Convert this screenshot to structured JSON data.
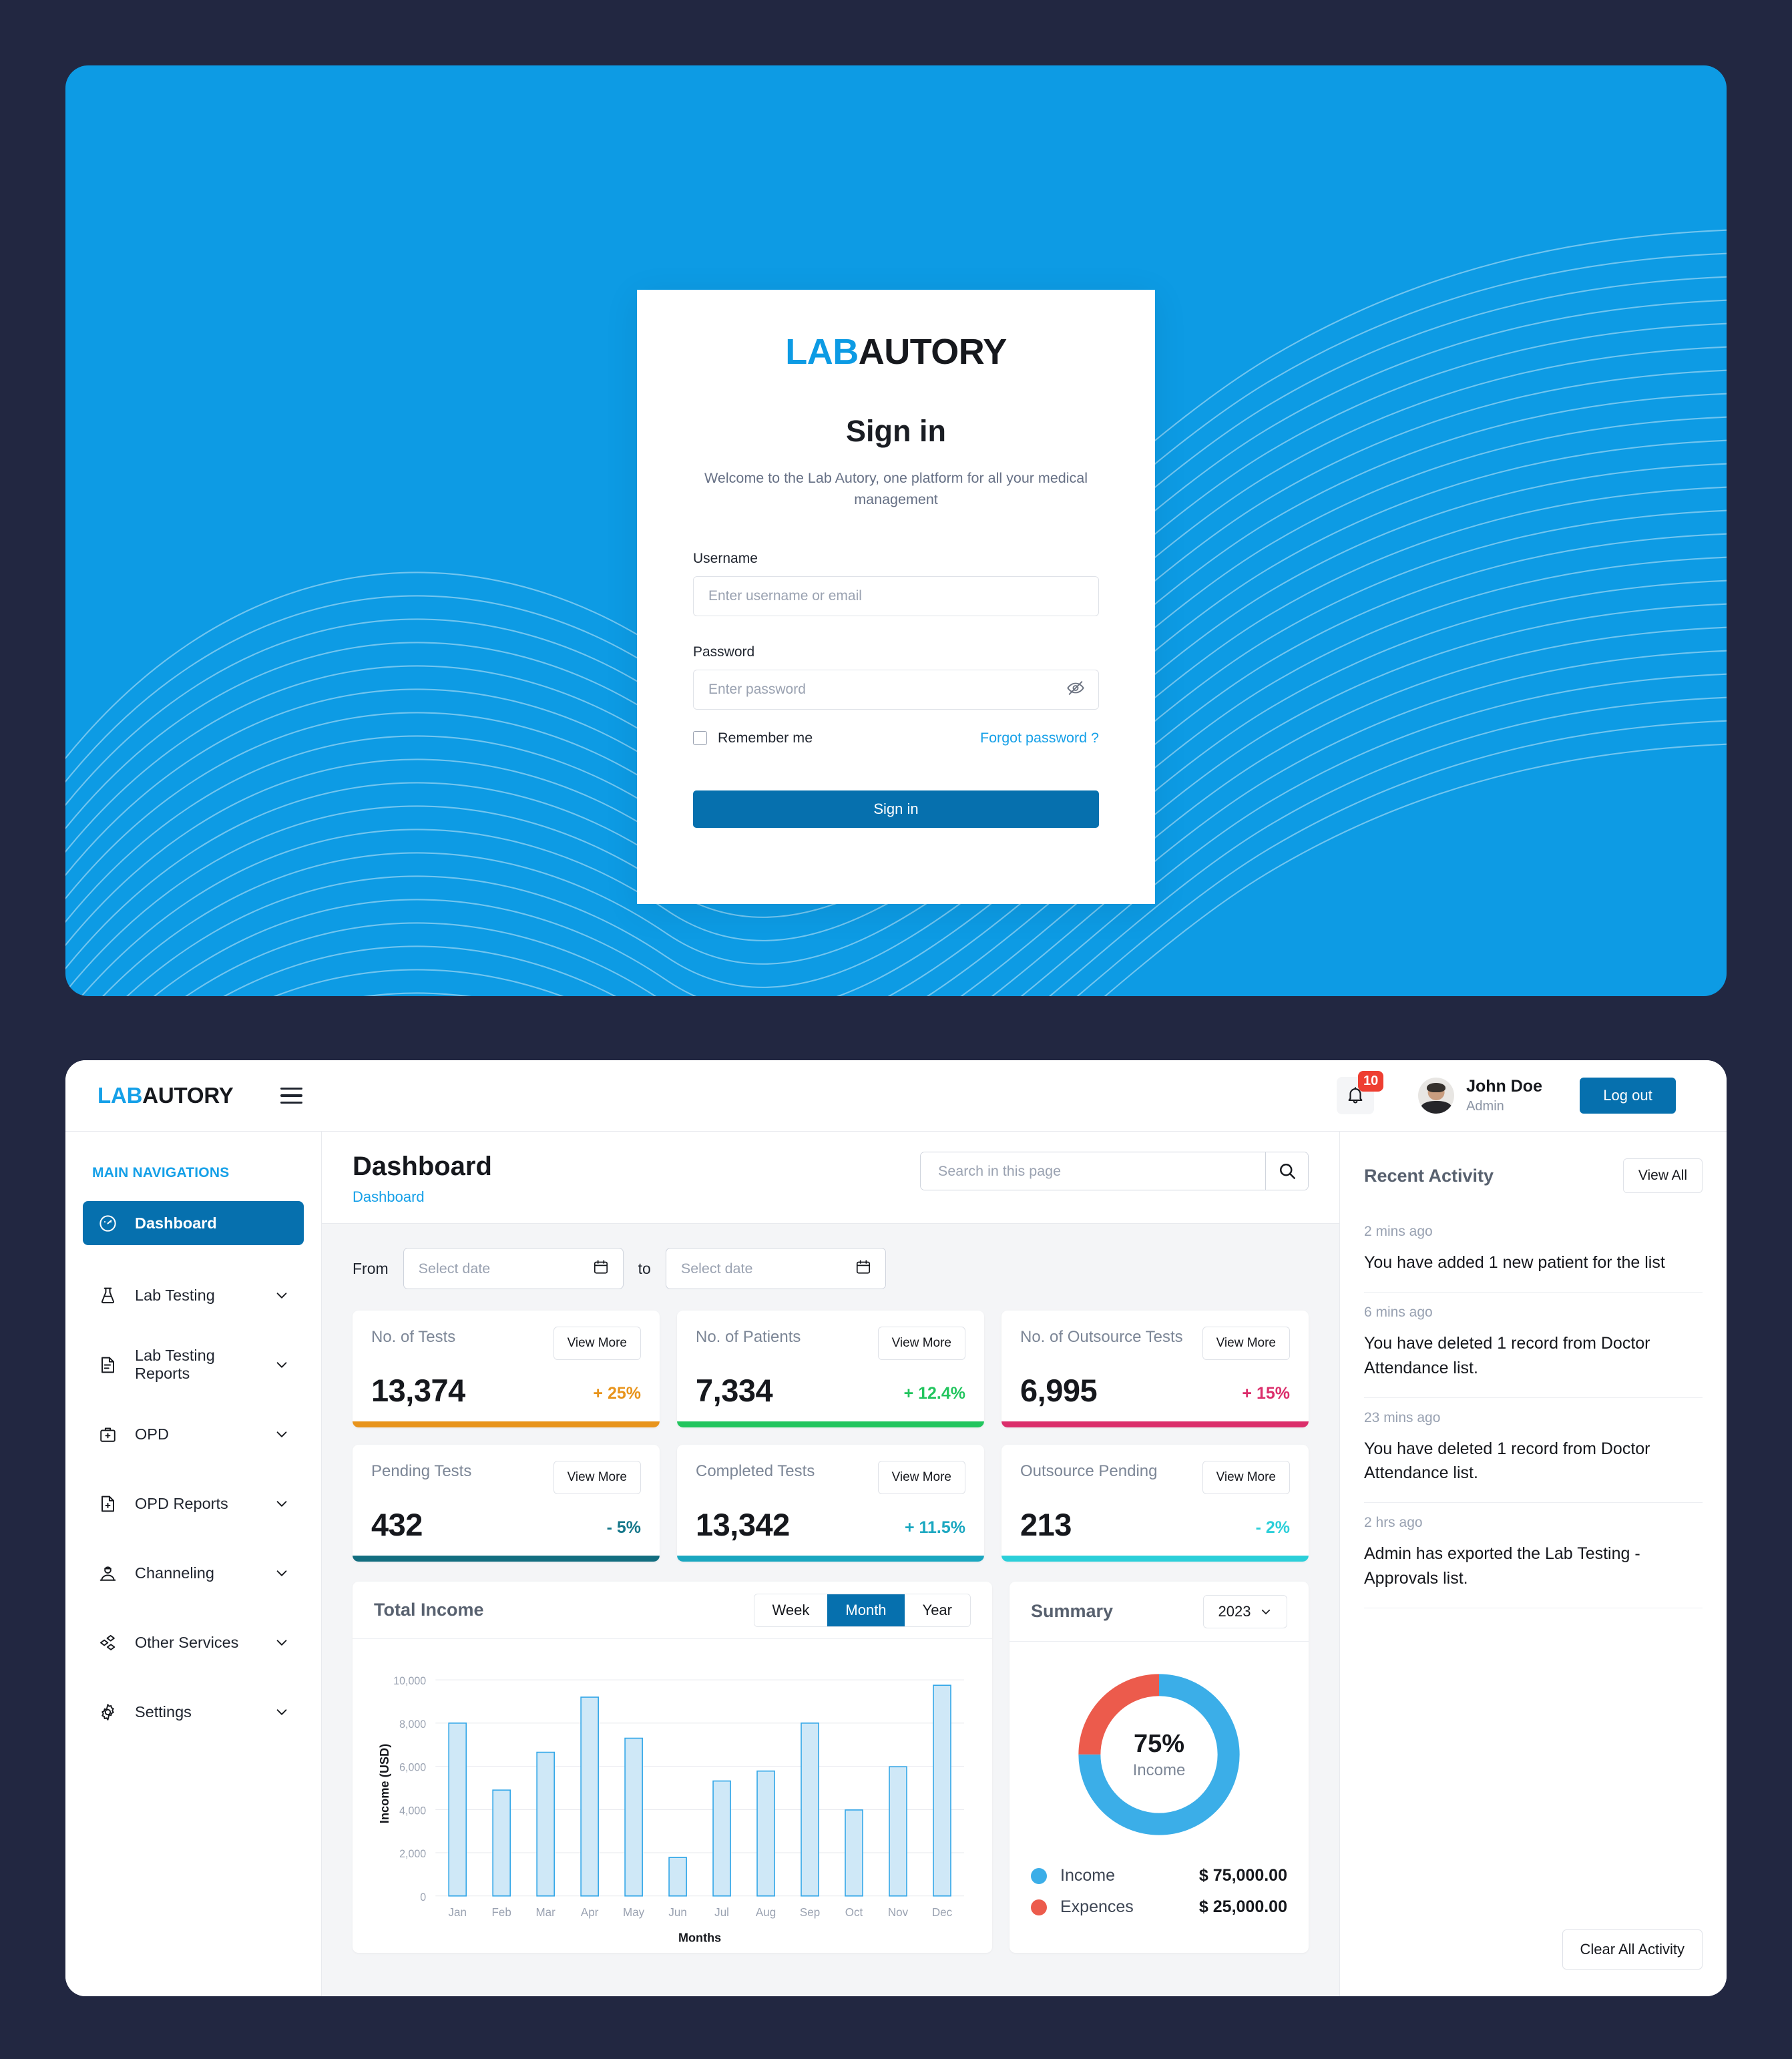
{
  "theme": {
    "bg_dark": "#222741",
    "brand_blue": "#15A0E8",
    "panel_blue": "#0D9BE4",
    "button_blue": "#0670AE",
    "badge_red": "#EE3E31"
  },
  "login": {
    "brand_prefix": "LAB",
    "brand_suffix": "AUTORY",
    "title": "Sign in",
    "subtitle": "Welcome to the Lab Autory, one platform for all your medical management",
    "username_label": "Username",
    "username_placeholder": "Enter username or email",
    "username_value": "",
    "password_label": "Password",
    "password_placeholder": "Enter password",
    "password_value": "",
    "remember_label": "Remember me",
    "remember_checked": false,
    "forgot_label": "Forgot password ?",
    "submit_label": "Sign in"
  },
  "topbar": {
    "brand_prefix": "LAB",
    "brand_suffix": "AUTORY",
    "notification_count": "10",
    "user_name": "John Doe",
    "user_role": "Admin",
    "logout_label": "Log out"
  },
  "sidebar": {
    "section_title": "MAIN NAVIGATIONS",
    "items": [
      {
        "label": "Dashboard",
        "icon": "gauge-icon",
        "active": true,
        "expandable": false
      },
      {
        "label": "Lab Testing",
        "icon": "flask-icon",
        "active": false,
        "expandable": true
      },
      {
        "label": "Lab Testing Reports",
        "icon": "document-lines-icon",
        "active": false,
        "expandable": true
      },
      {
        "label": "OPD",
        "icon": "medical-bag-icon",
        "active": false,
        "expandable": true
      },
      {
        "label": "OPD Reports",
        "icon": "document-plus-icon",
        "active": false,
        "expandable": true
      },
      {
        "label": "Channeling",
        "icon": "doctor-icon",
        "active": false,
        "expandable": true
      },
      {
        "label": "Other Services",
        "icon": "diamonds-icon",
        "active": false,
        "expandable": true
      },
      {
        "label": "Settings",
        "icon": "gear-icon",
        "active": false,
        "expandable": true
      }
    ]
  },
  "page": {
    "title": "Dashboard",
    "breadcrumb": "Dashboard",
    "search_placeholder": "Search in this page",
    "search_value": ""
  },
  "date_filter": {
    "from_label": "From",
    "from_placeholder": "Select date",
    "from_value": "",
    "to_label": "to",
    "to_placeholder": "Select date",
    "to_value": ""
  },
  "stat_cards": [
    {
      "label": "No. of Tests",
      "value": "13,374",
      "delta": "+ 25%",
      "delta_color": "#E8941C",
      "accent": "#E8941C",
      "action": "View More"
    },
    {
      "label": "No. of Patients",
      "value": "7,334",
      "delta": "+ 12.4%",
      "delta_color": "#22C55E",
      "accent": "#22C55E",
      "action": "View More"
    },
    {
      "label": "No. of Outsource Tests",
      "value": "6,995",
      "delta": "+ 15%",
      "delta_color": "#DB2E6B",
      "accent": "#DB2E6B",
      "action": "View More"
    },
    {
      "label": "Pending Tests",
      "value": "432",
      "delta": "- 5%",
      "delta_color": "#16778A",
      "accent": "#136E80",
      "action": "View More"
    },
    {
      "label": "Completed Tests",
      "value": "13,342",
      "delta": "+ 11.5%",
      "delta_color": "#1AA7C0",
      "accent": "#1AA7C0",
      "action": "View More"
    },
    {
      "label": "Outsource Pending",
      "value": "213",
      "delta": "- 2%",
      "delta_color": "#2CCFD9",
      "accent": "#2CCFD9",
      "action": "View More"
    }
  ],
  "income_panel": {
    "title": "Total Income",
    "range_options": [
      "Week",
      "Month",
      "Year"
    ],
    "range_selected": "Month"
  },
  "summary_panel": {
    "title": "Summary",
    "year_selected": "2023",
    "center_pct": "75%",
    "center_label": "Income",
    "legend": [
      {
        "name": "Income",
        "value": "$ 75,000.00",
        "color": "#3BAEE8"
      },
      {
        "name": "Expences",
        "value": "$ 25,000.00",
        "color": "#EC5B4C"
      }
    ]
  },
  "activity": {
    "title": "Recent Activity",
    "view_all_label": "View All",
    "clear_label": "Clear All Activity",
    "items": [
      {
        "time": "2 mins ago",
        "text": "You have added 1 new patient for the list"
      },
      {
        "time": "6 mins ago",
        "text": "You have deleted 1 record from Doctor Attendance  list."
      },
      {
        "time": "23 mins ago",
        "text": "You have deleted 1 record from Doctor Attendance  list."
      },
      {
        "time": "2 hrs ago",
        "text": "Admin has exported the Lab Testing - Approvals list."
      }
    ]
  },
  "chart_data": [
    {
      "type": "bar",
      "title": "Total Income",
      "xlabel": "Months",
      "ylabel": "Income (USD)",
      "categories": [
        "Jan",
        "Feb",
        "Mar",
        "Apr",
        "May",
        "Jun",
        "Jul",
        "Aug",
        "Sep",
        "Oct",
        "Nov",
        "Dec"
      ],
      "values": [
        8000,
        4900,
        6650,
        9200,
        7300,
        1780,
        5320,
        5780,
        8000,
        3980,
        5980,
        9750
      ],
      "ylim": [
        0,
        10400
      ],
      "yticks": [
        0,
        2000,
        4000,
        6000,
        8000,
        10000
      ],
      "ytick_labels": [
        "0",
        "2,000",
        "4,000",
        "6,000",
        "8,000",
        "10,000"
      ],
      "grid": true,
      "bar_fill": "#CFE8F7",
      "bar_stroke": "#33A7E8",
      "legend": []
    },
    {
      "type": "pie",
      "title": "Summary",
      "labels": [
        "Income",
        "Expences"
      ],
      "values": [
        75000,
        25000
      ],
      "percentages": [
        75,
        25
      ],
      "colors": [
        "#3BAEE8",
        "#EC5B4C"
      ],
      "donut": true,
      "center_text": "75%",
      "center_subtext": "Income",
      "legend_position": "bottom"
    }
  ]
}
